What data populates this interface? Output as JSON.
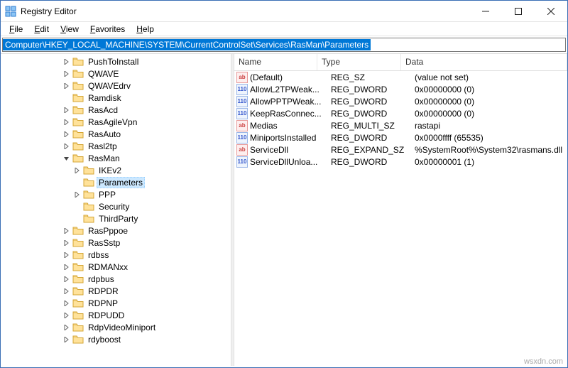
{
  "title": "Registry Editor",
  "menus": [
    "File",
    "Edit",
    "View",
    "Favorites",
    "Help"
  ],
  "address": "Computer\\HKEY_LOCAL_MACHINE\\SYSTEM\\CurrentControlSet\\Services\\RasMan\\Parameters",
  "tree": {
    "indents": {
      "a": 85,
      "b": 100,
      "c": 115
    },
    "items": [
      {
        "l": "a",
        "exp": ">",
        "label": "PushToInstall"
      },
      {
        "l": "a",
        "exp": ">",
        "label": "QWAVE"
      },
      {
        "l": "a",
        "exp": ">",
        "label": "QWAVEdrv"
      },
      {
        "l": "a",
        "exp": "",
        "label": "Ramdisk"
      },
      {
        "l": "a",
        "exp": ">",
        "label": "RasAcd"
      },
      {
        "l": "a",
        "exp": ">",
        "label": "RasAgileVpn"
      },
      {
        "l": "a",
        "exp": ">",
        "label": "RasAuto"
      },
      {
        "l": "a",
        "exp": ">",
        "label": "Rasl2tp"
      },
      {
        "l": "a",
        "exp": "v",
        "label": "RasMan"
      },
      {
        "l": "b",
        "exp": ">",
        "label": "IKEv2"
      },
      {
        "l": "b",
        "exp": "",
        "label": "Parameters",
        "selected": true
      },
      {
        "l": "b",
        "exp": ">",
        "label": "PPP"
      },
      {
        "l": "b",
        "exp": "",
        "label": "Security"
      },
      {
        "l": "b",
        "exp": "",
        "label": "ThirdParty"
      },
      {
        "l": "a",
        "exp": ">",
        "label": "RasPppoe"
      },
      {
        "l": "a",
        "exp": ">",
        "label": "RasSstp"
      },
      {
        "l": "a",
        "exp": ">",
        "label": "rdbss"
      },
      {
        "l": "a",
        "exp": ">",
        "label": "RDMANxx"
      },
      {
        "l": "a",
        "exp": ">",
        "label": "rdpbus"
      },
      {
        "l": "a",
        "exp": ">",
        "label": "RDPDR"
      },
      {
        "l": "a",
        "exp": ">",
        "label": "RDPNP"
      },
      {
        "l": "a",
        "exp": ">",
        "label": "RDPUDD"
      },
      {
        "l": "a",
        "exp": ">",
        "label": "RdpVideoMiniport"
      },
      {
        "l": "a",
        "exp": ">",
        "label": "rdyboost"
      }
    ]
  },
  "columns": {
    "name": "Name",
    "type": "Type",
    "data": "Data"
  },
  "values": [
    {
      "icon": "sz",
      "name": "(Default)",
      "type": "REG_SZ",
      "data": "(value not set)"
    },
    {
      "icon": "dw",
      "name": "AllowL2TPWeak...",
      "type": "REG_DWORD",
      "data": "0x00000000 (0)"
    },
    {
      "icon": "dw",
      "name": "AllowPPTPWeak...",
      "type": "REG_DWORD",
      "data": "0x00000000 (0)"
    },
    {
      "icon": "dw",
      "name": "KeepRasConnec...",
      "type": "REG_DWORD",
      "data": "0x00000000 (0)"
    },
    {
      "icon": "sz",
      "name": "Medias",
      "type": "REG_MULTI_SZ",
      "data": "rastapi"
    },
    {
      "icon": "dw",
      "name": "MiniportsInstalled",
      "type": "REG_DWORD",
      "data": "0x0000ffff (65535)"
    },
    {
      "icon": "sz",
      "name": "ServiceDll",
      "type": "REG_EXPAND_SZ",
      "data": "%SystemRoot%\\System32\\rasmans.dll"
    },
    {
      "icon": "dw",
      "name": "ServiceDllUnloa...",
      "type": "REG_DWORD",
      "data": "0x00000001 (1)"
    }
  ],
  "watermark": "wsxdn.com"
}
